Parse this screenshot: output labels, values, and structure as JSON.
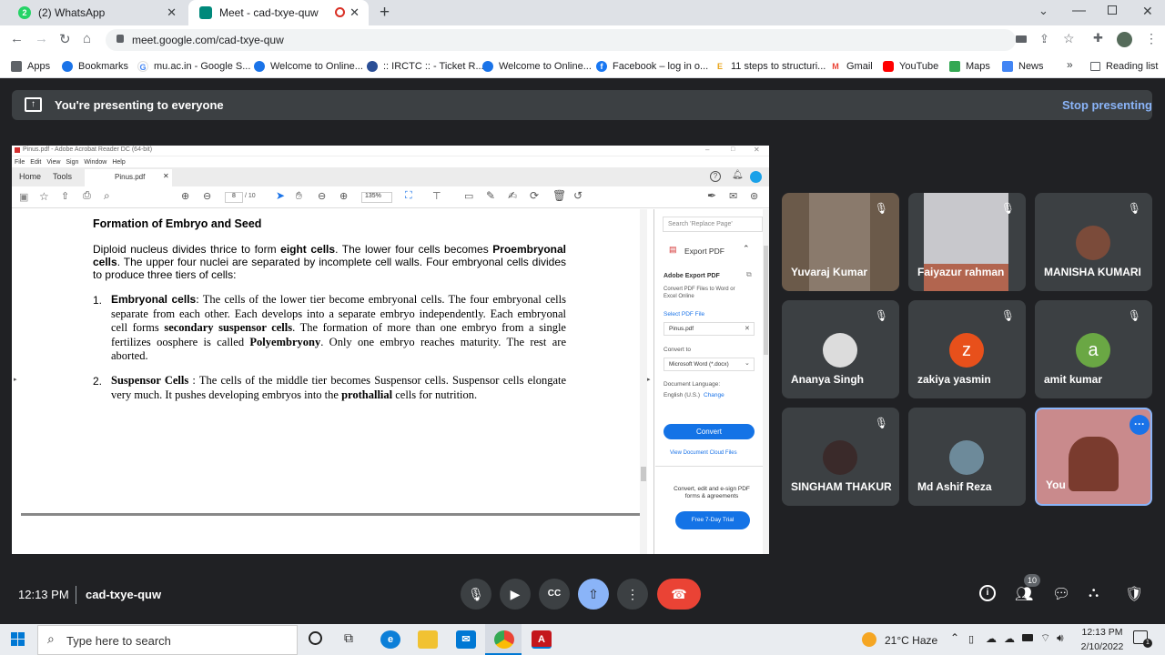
{
  "browser": {
    "tabs": [
      {
        "title": "(2) WhatsApp",
        "badge": "2"
      },
      {
        "title": "Meet - cad-txye-quw"
      }
    ],
    "url": "meet.google.com/cad-txye-quw",
    "bookmarks": [
      "Apps",
      "Bookmarks",
      "mu.ac.in - Google S...",
      "Welcome to Online...",
      ":: IRCTC :: - Ticket R...",
      "Welcome to Online...",
      "Facebook – log in o...",
      "11 steps to structuri...",
      "Gmail",
      "YouTube",
      "Maps",
      "News"
    ],
    "reading_list": "Reading list",
    "more": "»"
  },
  "meet": {
    "banner": "You're presenting to everyone",
    "stop": "Stop presenting",
    "time": "12:13 PM",
    "meeting_code": "cad-txye-quw",
    "people_count": "10",
    "participants": [
      {
        "name": "Yuvaraj Kumar"
      },
      {
        "name": "Faiyazur rahman"
      },
      {
        "name": "MANISHA KUMARI"
      },
      {
        "name": "Ananya Singh"
      },
      {
        "name": "zakiya yasmin",
        "initial": "z",
        "color": "#e8501b"
      },
      {
        "name": "amit kumar",
        "initial": "a",
        "color": "#6aa744"
      },
      {
        "name": "SINGHAM THAKUR"
      },
      {
        "name": "Md Ashif Reza"
      },
      {
        "name": "You"
      }
    ]
  },
  "reader": {
    "window_title": "Pinus.pdf - Adobe Acrobat Reader DC (64-bit)",
    "menu": [
      "File",
      "Edit",
      "View",
      "Sign",
      "Window",
      "Help"
    ],
    "tabs": {
      "home": "Home",
      "tools": "Tools",
      "doc": "Pinus.pdf"
    },
    "page_current": "8",
    "page_total": "/ 10",
    "zoom": "135%",
    "heading": "Formation of Embryo and Seed",
    "intro": [
      "Diploid nucleus divides thrice to form ",
      "eight cells",
      ". The lower four cells becomes ",
      "Proembryonal cells",
      ". The upper four nuclei are separated by incomplete cell walls. Four embryonal cells divides to produce three tiers of cells:"
    ],
    "item1": {
      "num": "1.",
      "parts": [
        "Embryonal cells",
        ": The cells of the lower tier become embryonal cells. The four embryonal cells separate from each other. Each develops into a separate embryo independently. Each embryonal cell forms ",
        "secondary suspensor cells",
        ". The formation of more than one embryo from a single fertilizes oosphere is called ",
        "Polyembryony",
        ". Only one embryo reaches maturity. The rest are aborted."
      ]
    },
    "item2": {
      "num": "2.",
      "parts": [
        "Suspensor Cells",
        " : The cells of the middle tier becomes Suspensor cells. Suspensor cells elongate very much. It pushes developing embryos into the ",
        "prothallial",
        " cells for nutrition."
      ]
    },
    "side": {
      "search": "Search 'Replace Page'",
      "export": "Export PDF",
      "adobe_export": "Adobe Export PDF",
      "desc": "Convert PDF Files to Word or Excel Online",
      "select": "Select PDF File",
      "file": "Pinus.pdf",
      "convert_to": "Convert to",
      "format": "Microsoft Word (*.docx)",
      "lang_label": "Document Language:",
      "lang": "English (U.S.)",
      "change": "Change",
      "convert_btn": "Convert",
      "view_cloud": "View Document Cloud Files",
      "promo": "Convert, edit and e-sign PDF forms & agreements",
      "trial": "Free 7-Day Trial"
    }
  },
  "taskbar": {
    "search": "Type here to search",
    "weather": "21°C  Haze",
    "time": "12:13 PM",
    "date": "2/10/2022"
  }
}
